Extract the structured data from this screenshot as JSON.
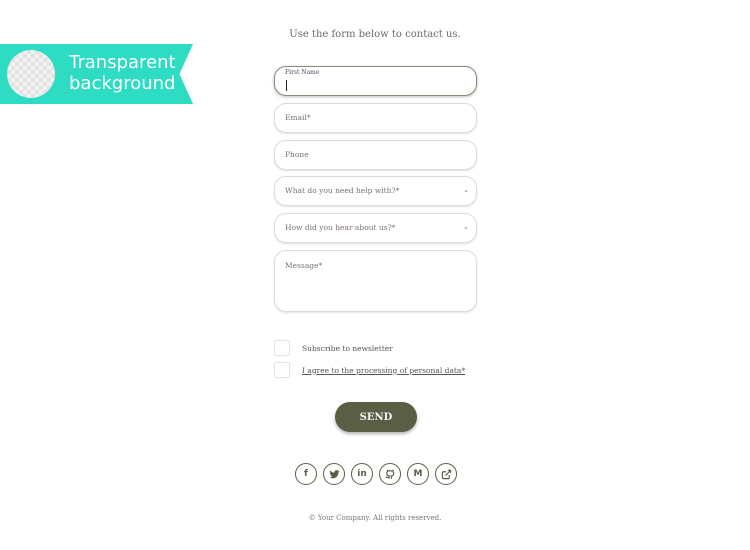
{
  "badge": {
    "line1": "Transparent",
    "line2": "background"
  },
  "intro_text": "Use the form below to contact us.",
  "form": {
    "first_name": {
      "label": "First Name",
      "value": ""
    },
    "email": {
      "placeholder": "Email*"
    },
    "phone": {
      "placeholder": "Phone"
    },
    "help_select": {
      "placeholder": "What do you need help with?*"
    },
    "hear_select": {
      "placeholder": "How did you hear about us?*"
    },
    "message": {
      "placeholder": "Message*"
    },
    "newsletter_label": "Subscribe to newsletter",
    "consent_label": "I agree to the processing of personal data*",
    "send_label": "SEND"
  },
  "social": [
    {
      "name": "facebook-icon",
      "glyph": "f"
    },
    {
      "name": "twitter-icon",
      "glyph": ""
    },
    {
      "name": "linkedin-icon",
      "glyph": "in"
    },
    {
      "name": "github-icon",
      "glyph": ""
    },
    {
      "name": "medium-icon",
      "glyph": "M"
    },
    {
      "name": "external-link-icon",
      "glyph": ""
    }
  ],
  "footer": "© Your Company. All rights reserved."
}
